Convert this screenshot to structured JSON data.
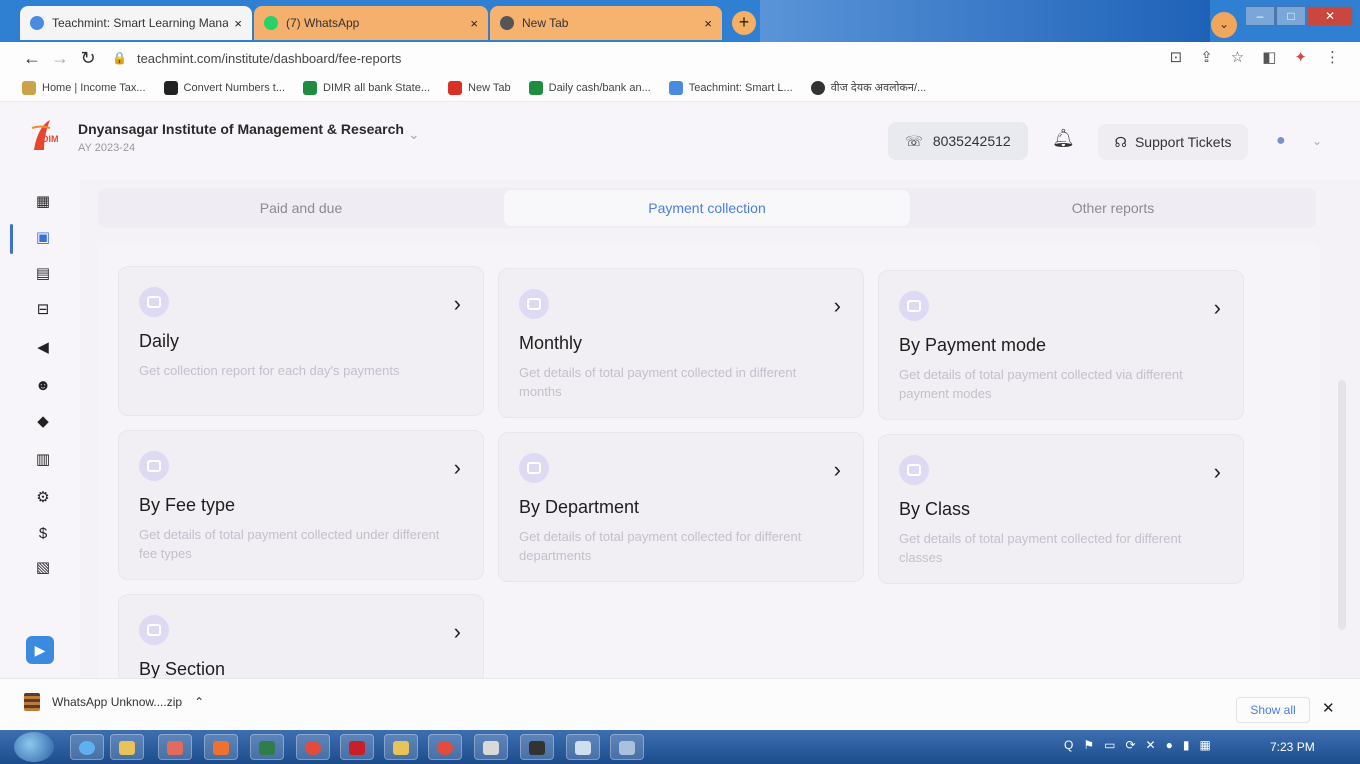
{
  "browser": {
    "tabs": [
      {
        "title": "Teachmint: Smart Learning Mana",
        "color": "#4a8be0"
      },
      {
        "title": "(7) WhatsApp",
        "color": "#25d366"
      },
      {
        "title": "New Tab",
        "color": "#555555"
      }
    ],
    "close_glyph": "×",
    "new_tab_glyph": "+",
    "url": "teachmint.com/institute/dashboard/fee-reports",
    "bookmarks": [
      "Home | Income Tax...",
      "Convert Numbers t...",
      "DIMR all bank State...",
      "New Tab",
      "Daily cash/bank an...",
      "Teachmint: Smart L...",
      "वीज देयक अवलोकन/..."
    ]
  },
  "header": {
    "institute_name": "Dnyansagar Institute of Management & Research",
    "academic_year": "AY 2023-24",
    "logo_text": "DIM",
    "phone": "8035242512",
    "support_label": "Support Tickets"
  },
  "subtabs": [
    "Paid and due",
    "Payment collection",
    "Other reports"
  ],
  "cards": [
    {
      "title": "Daily",
      "desc": "Get collection report for each day's payments"
    },
    {
      "title": "Monthly",
      "desc": "Get details of total payment collected in different months"
    },
    {
      "title": "By Payment mode",
      "desc": "Get details of total payment collected via different payment modes"
    },
    {
      "title": "By Fee type",
      "desc": "Get details of total payment collected under different fee types"
    },
    {
      "title": "By Department",
      "desc": "Get details of total payment collected for different departments"
    },
    {
      "title": "By Class",
      "desc": "Get details of total payment collected for different classes"
    },
    {
      "title": "By Section",
      "desc": ""
    }
  ],
  "download": {
    "file": "WhatsApp Unknow....zip",
    "show_all": "Show all"
  },
  "taskbar": {
    "clock": "7:23 PM"
  },
  "colors": {
    "accent": "#4a7ee0",
    "card_icon": "#dfdaf4"
  }
}
